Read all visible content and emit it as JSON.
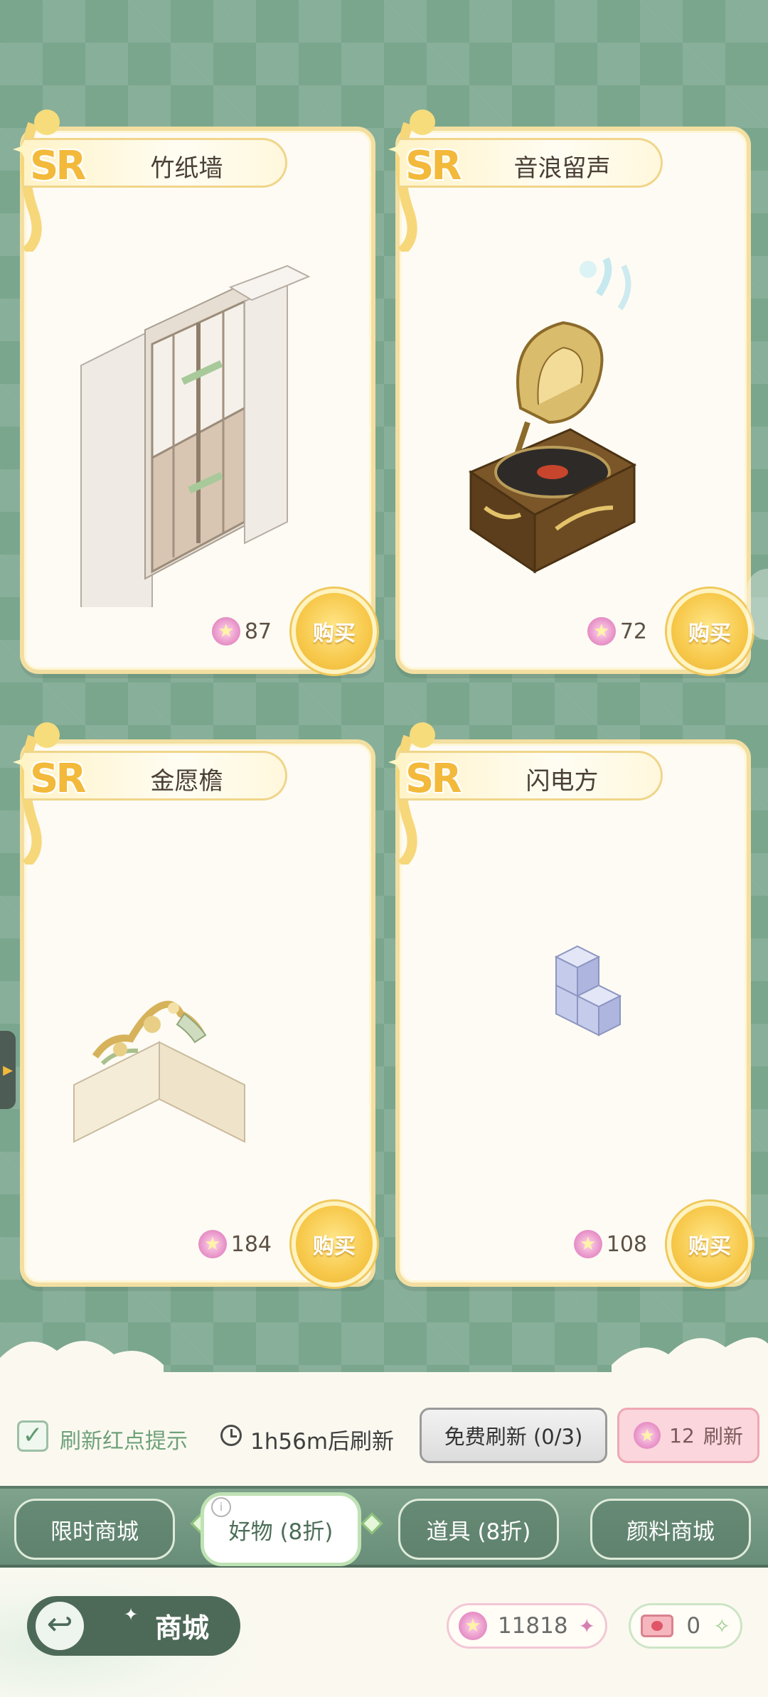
{
  "cards": [
    {
      "rarity": "SR",
      "name": "竹纸墙",
      "price": "87",
      "buy_label": "购买",
      "item_icon": "bamboo-paper-wall-icon"
    },
    {
      "rarity": "SR",
      "name": "音浪留声",
      "price": "72",
      "buy_label": "购买",
      "item_icon": "gramophone-icon"
    },
    {
      "rarity": "SR",
      "name": "金愿檐",
      "price": "184",
      "buy_label": "购买",
      "item_icon": "golden-eave-icon"
    },
    {
      "rarity": "SR",
      "name": "闪电方",
      "price": "108",
      "buy_label": "购买",
      "item_icon": "lightning-block-icon"
    }
  ],
  "refresh": {
    "checkbox_label": "刷新红点提示",
    "checked": true,
    "timer": "1h56m后刷新",
    "free_refresh_label": "免费刷新 (0/3)",
    "paid_refresh_cost": "12",
    "paid_refresh_label": "刷新"
  },
  "tabs": [
    {
      "label": "限时商城",
      "active": false
    },
    {
      "label": "好物 (8折)",
      "active": true
    },
    {
      "label": "道具 (8折)",
      "active": false
    },
    {
      "label": "颜料商城",
      "active": false
    }
  ],
  "bottom": {
    "title": "商城",
    "star_balance": "11818",
    "ticket_balance": "0"
  },
  "colors": {
    "background": "#7aa68d",
    "card_border": "#f3dfa1",
    "accent_gold": "#f2b93b",
    "star_pink": "#e58cc4",
    "tab_active_border": "#bfe2b4"
  }
}
